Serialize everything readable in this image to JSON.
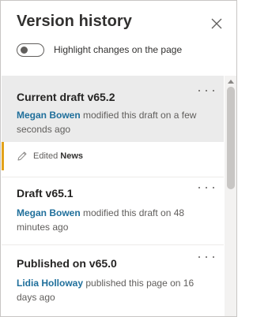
{
  "panel": {
    "title": "Version history",
    "close_icon": "close-icon"
  },
  "toggle": {
    "label": "Highlight changes on the page",
    "state": "off"
  },
  "versions": [
    {
      "title": "Current draft v65.2",
      "author": "Megan Bowen",
      "description": " modified this draft on a few seconds ago",
      "selected": true
    },
    {
      "title": "Draft v65.1",
      "author": "Megan Bowen",
      "description": " modified this draft on 48 minutes ago"
    },
    {
      "title": "Published on v65.0",
      "author": "Lidia Holloway",
      "description": " published this page on 16 days ago"
    }
  ],
  "edit_entry": {
    "prefix": "Edited",
    "target": "News",
    "icon": "pencil-icon"
  },
  "colors": {
    "author_link": "#1f6f9b",
    "selected_bg": "#ebebeb",
    "edit_accent": "#e3a21a"
  }
}
